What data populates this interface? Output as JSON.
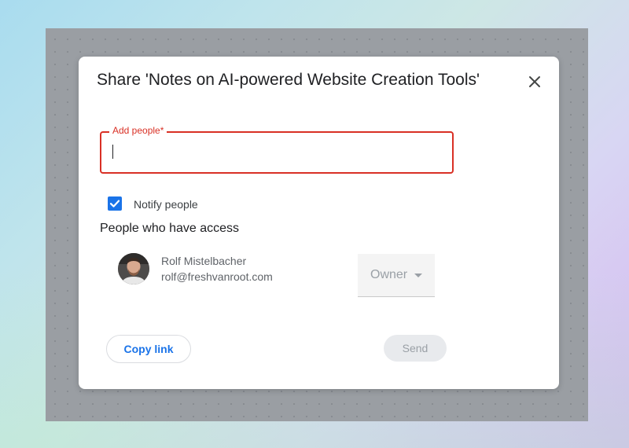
{
  "dialog": {
    "title": "Share 'Notes on AI-powered Website Creation Tools'",
    "close_icon": "close-icon"
  },
  "add_people": {
    "label": "Add people*",
    "value": "",
    "placeholder": "",
    "accent_color": "#d93025"
  },
  "notify": {
    "label": "Notify people",
    "checked": true,
    "accent_color": "#1a73e8"
  },
  "access": {
    "heading": "People who have access",
    "users": [
      {
        "name": "Rolf Mistelbacher",
        "email": "rolf@freshvanroot.com",
        "role": "Owner",
        "role_icon": "chevron-down-icon"
      }
    ]
  },
  "actions": {
    "copy_link_label": "Copy link",
    "send_label": "Send",
    "copy_link_color": "#1a73e8"
  }
}
